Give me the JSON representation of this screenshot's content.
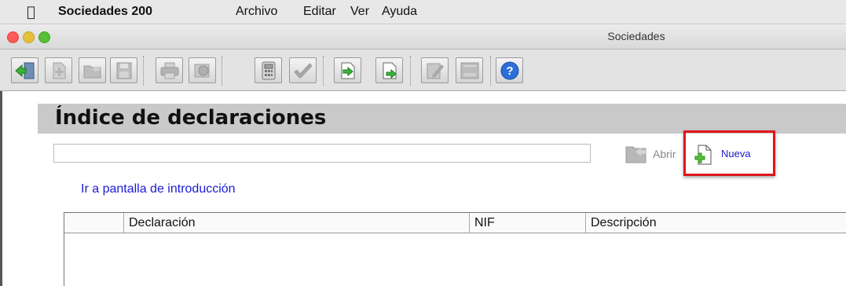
{
  "menubar": {
    "app_name": "Sociedades 200",
    "items": [
      "Archivo",
      "Editar",
      "Ver",
      "Ayuda"
    ]
  },
  "window": {
    "title": "Sociedades",
    "traffic_lights": {
      "close": "#fc5b57",
      "minimize": "#e5bf3c",
      "zoom": "#57c038"
    }
  },
  "toolbar": {
    "buttons": [
      "exit-door-icon",
      "new-document-icon",
      "open-folder-icon",
      "save-disk-icon",
      "print-icon",
      "preview-icon",
      "calculator-icon",
      "checkmark-icon",
      "import-icon",
      "export-icon",
      "edit-icon",
      "form-icon",
      "help-icon"
    ]
  },
  "main": {
    "title": "Índice de declaraciones",
    "search": {
      "value": "",
      "placeholder": ""
    },
    "open_label": "Abrir",
    "new_label": "Nueva",
    "intro_link": "Ir a pantalla de introducción",
    "table": {
      "columns": [
        "",
        "Declaración",
        "NIF",
        "Descripción"
      ],
      "rows": []
    },
    "highlight_color": "#e0161b",
    "link_color": "#1a1ad6"
  }
}
